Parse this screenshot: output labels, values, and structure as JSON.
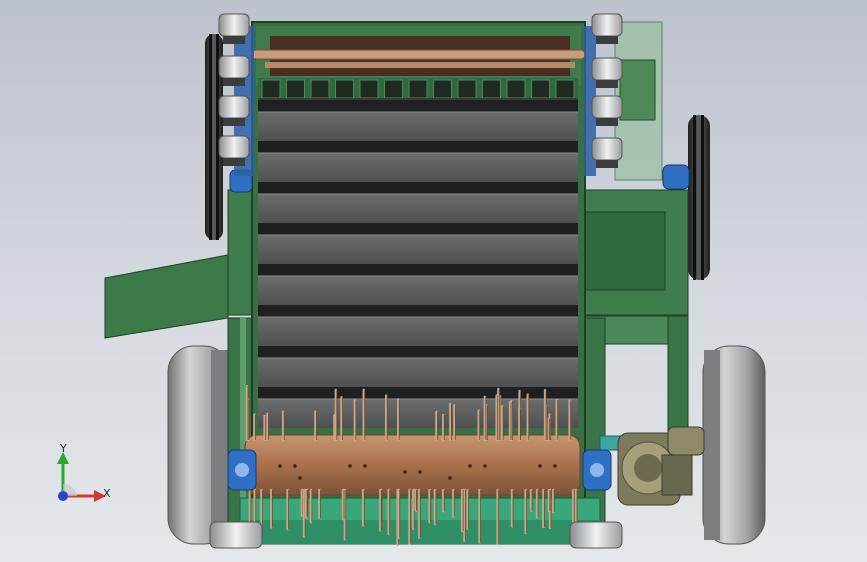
{
  "viewport": {
    "background_top": "#bcc2cb",
    "background_bottom": "#e4e7eb"
  },
  "colors": {
    "frame_green": "#3f7d4c",
    "frame_green_dark": "#2c5a36",
    "frame_green_light": "#6aa67a",
    "plate_gray": "#5c5e60",
    "plate_dark": "#2f3133",
    "rotor_copper": "#b07a55",
    "spike_tan": "#c9a887",
    "tire_gray": "#9a9c9f",
    "bearing_blue": "#2f6fc4",
    "shaft_teal": "#3aa6a6"
  },
  "triad": {
    "x_label": "X",
    "y_label": "Y",
    "x_color": "#d43a2a",
    "y_color": "#29a82e",
    "z_color": "#2a44c9"
  }
}
